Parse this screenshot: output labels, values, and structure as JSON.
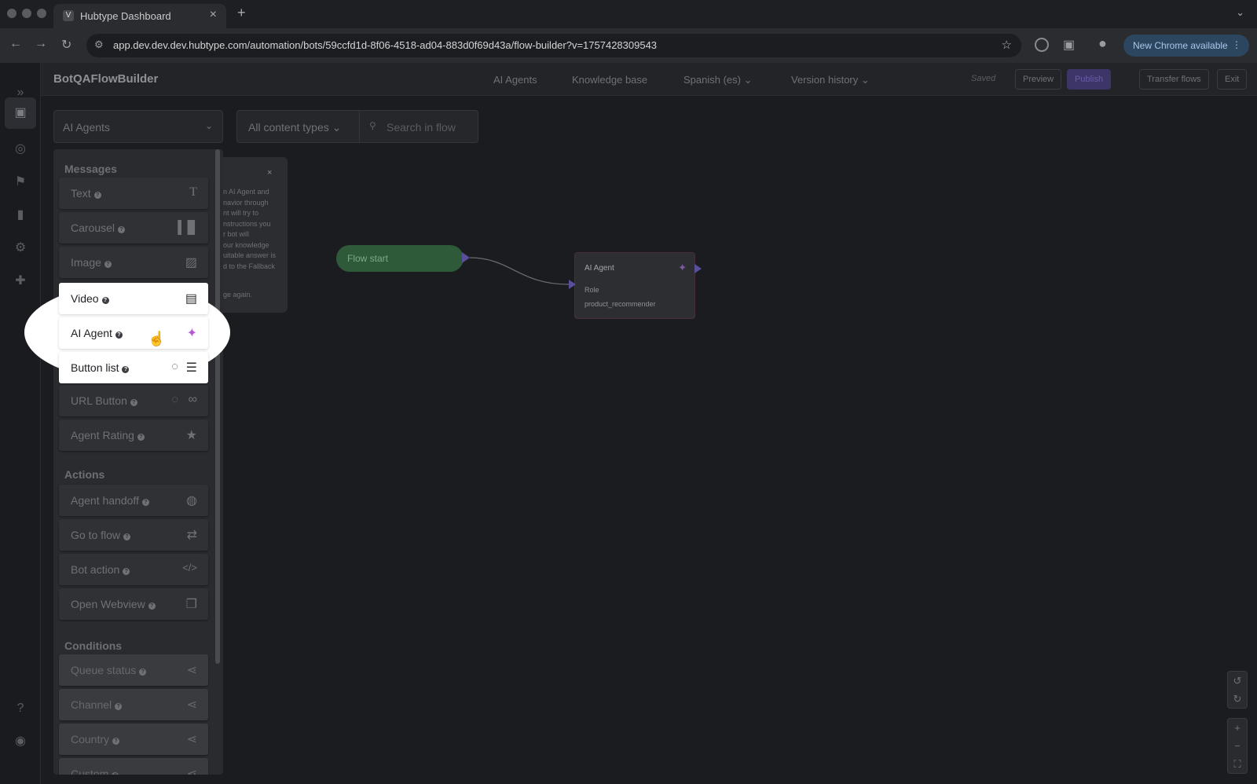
{
  "browser": {
    "tab_title": "Hubtype Dashboard",
    "tab_favicon": "V",
    "url": "app.dev.dev.dev.hubtype.com/automation/bots/59ccfd1d-8f06-4518-ad04-883d0f69d43a/flow-builder?v=1757428309543",
    "update_button": "New Chrome available"
  },
  "header": {
    "app_name": "BotQAFlowBuilder",
    "nav": [
      "AI Agents",
      "Knowledge base",
      "Spanish (es)",
      "Version history"
    ],
    "saved": "Saved",
    "preview": "Preview",
    "publish": "Publish",
    "transfer": "Transfer flows",
    "exit": "Exit"
  },
  "toolbar": {
    "flow_select": "AI Agents",
    "content_filter": "All content types",
    "search_placeholder": "Search in flow"
  },
  "info_card": {
    "lines": "n AI Agent and\nnavior through\nnt will try to\nnstructions you\nr bot will\nour knowledge\nuitable answer is\nd to the Fallback",
    "tail": "ge again."
  },
  "palette": {
    "messages_title": "Messages",
    "messages": [
      {
        "label": "Text",
        "icon": "text-icon"
      },
      {
        "label": "Carousel",
        "icon": "carousel-icon"
      },
      {
        "label": "Image",
        "icon": "image-icon"
      },
      {
        "label": "Video",
        "icon": "video-icon"
      },
      {
        "label": "AI Agent",
        "icon": "magic-wand-icon"
      },
      {
        "label": "Button list",
        "icon": "list-icon"
      },
      {
        "label": "URL Button",
        "icon": "link-icon"
      },
      {
        "label": "Agent Rating",
        "icon": "star-icon"
      }
    ],
    "actions_title": "Actions",
    "actions": [
      {
        "label": "Agent handoff",
        "icon": "headset-icon"
      },
      {
        "label": "Go to flow",
        "icon": "redirect-icon"
      },
      {
        "label": "Bot action",
        "icon": "code-icon"
      },
      {
        "label": "Open Webview",
        "icon": "window-icon"
      }
    ],
    "conditions_title": "Conditions",
    "conditions": [
      {
        "label": "Queue status",
        "icon": "split-icon"
      },
      {
        "label": "Channel",
        "icon": "split-icon"
      },
      {
        "label": "Country",
        "icon": "split-icon"
      },
      {
        "label": "Custom",
        "icon": "split-icon"
      }
    ]
  },
  "flow": {
    "start_label": "Flow start",
    "agent_node": {
      "title": "AI Agent",
      "role_label": "Role",
      "role_value": "product_recommender"
    }
  },
  "colors": {
    "accent": "#5a4e9a",
    "flow_start": "#2f5a3a",
    "ai_agent_icon": "#b45ad8"
  }
}
